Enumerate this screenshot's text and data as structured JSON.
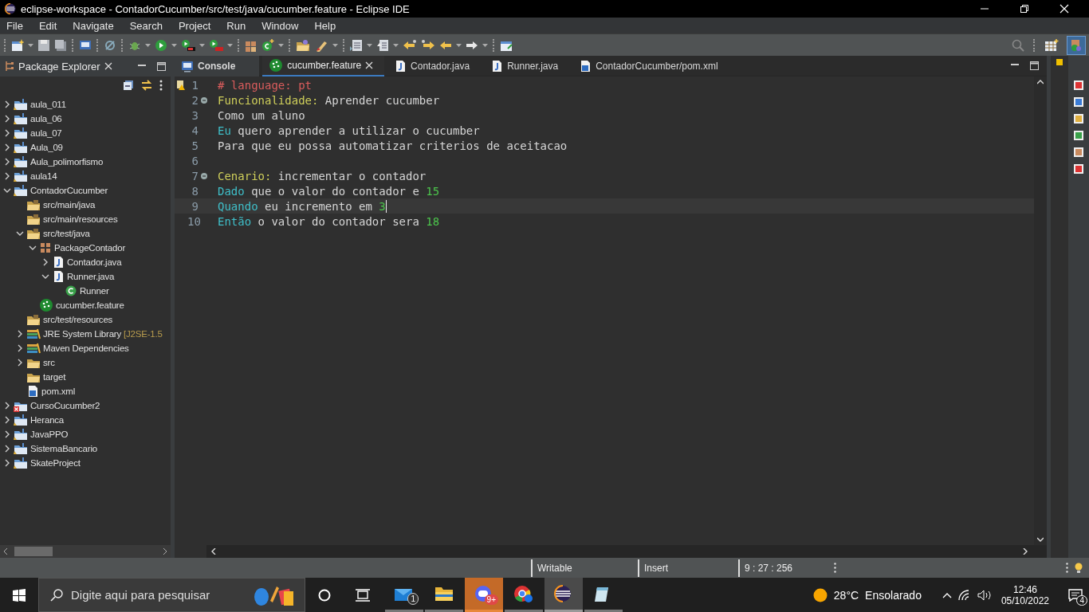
{
  "window": {
    "title": "eclipse-workspace - ContadorCucumber/src/test/java/cucumber.feature - Eclipse IDE"
  },
  "menu": [
    "File",
    "Edit",
    "Navigate",
    "Search",
    "Project",
    "Run",
    "Window",
    "Help"
  ],
  "explorer": {
    "title": "Package Explorer",
    "items": [
      {
        "label": "aula_011",
        "kind": "project",
        "expanded": false
      },
      {
        "label": "aula_06",
        "kind": "project",
        "expanded": false
      },
      {
        "label": "aula_07",
        "kind": "project",
        "expanded": false
      },
      {
        "label": "Aula_09",
        "kind": "project",
        "expanded": false
      },
      {
        "label": "Aula_polimorfismo",
        "kind": "project",
        "expanded": false
      },
      {
        "label": "aula14",
        "kind": "project",
        "expanded": false
      },
      {
        "label": "ContadorCucumber",
        "kind": "project",
        "expanded": true,
        "children": [
          {
            "label": "src/main/java",
            "kind": "source-folder"
          },
          {
            "label": "src/main/resources",
            "kind": "source-folder"
          },
          {
            "label": "src/test/java",
            "kind": "source-folder",
            "expanded": true,
            "children": [
              {
                "label": "PackageContador",
                "kind": "package",
                "expanded": true,
                "children": [
                  {
                    "label": "Contador.java",
                    "kind": "java",
                    "expanded": false
                  },
                  {
                    "label": "Runner.java",
                    "kind": "java",
                    "expanded": true,
                    "children": [
                      {
                        "label": "Runner",
                        "kind": "class"
                      }
                    ]
                  }
                ]
              },
              {
                "label": "cucumber.feature",
                "kind": "feature"
              }
            ]
          },
          {
            "label": "src/test/resources",
            "kind": "source-folder"
          },
          {
            "label": "JRE System Library",
            "decoration": "[J2SE-1.5",
            "kind": "library",
            "expanded": false
          },
          {
            "label": "Maven Dependencies",
            "kind": "library",
            "expanded": false
          },
          {
            "label": "src",
            "kind": "folder",
            "expanded": false
          },
          {
            "label": "target",
            "kind": "folder"
          },
          {
            "label": "pom.xml",
            "kind": "maven"
          }
        ]
      },
      {
        "label": "CursoCucumber2",
        "kind": "project-error",
        "expanded": false
      },
      {
        "label": "Heranca",
        "kind": "project",
        "expanded": false
      },
      {
        "label": "JavaPPO",
        "kind": "project",
        "expanded": false
      },
      {
        "label": "SistemaBancario",
        "kind": "project",
        "expanded": false
      },
      {
        "label": "SkateProject",
        "kind": "project",
        "expanded": false
      }
    ]
  },
  "editor": {
    "tabs": [
      {
        "label": "Console",
        "kind": "console",
        "selected": false
      },
      {
        "label": "cucumber.feature",
        "kind": "feature",
        "selected": true
      },
      {
        "label": "Contador.java",
        "kind": "java",
        "selected": false
      },
      {
        "label": "Runner.java",
        "kind": "java",
        "selected": false
      },
      {
        "label": "ContadorCucumber/pom.xml",
        "kind": "maven",
        "selected": false
      }
    ],
    "lines": [
      {
        "number": "1",
        "fold": false,
        "current": false,
        "segments": [
          {
            "kind": "comment",
            "text": "# language: pt"
          }
        ]
      },
      {
        "number": "2",
        "fold": true,
        "current": false,
        "segments": [
          {
            "kind": "feature",
            "text": "Funcionalidade:"
          },
          {
            "kind": "text",
            "text": " Aprender cucumber"
          }
        ]
      },
      {
        "number": "3",
        "fold": false,
        "current": false,
        "segments": [
          {
            "kind": "text",
            "text": "Como um aluno"
          }
        ]
      },
      {
        "number": "4",
        "fold": false,
        "current": false,
        "segments": [
          {
            "kind": "step",
            "text": "Eu"
          },
          {
            "kind": "text",
            "text": " quero aprender a utilizar o cucumber"
          }
        ]
      },
      {
        "number": "5",
        "fold": false,
        "current": false,
        "segments": [
          {
            "kind": "text",
            "text": "Para que eu possa automatizar criterios de aceitacao"
          }
        ]
      },
      {
        "number": "6",
        "fold": false,
        "current": false
      },
      {
        "number": "7",
        "fold": true,
        "current": false,
        "segments": [
          {
            "kind": "feature",
            "text": "Cenario:"
          },
          {
            "kind": "text",
            "text": " incrementar o contador"
          }
        ]
      },
      {
        "number": "8",
        "fold": false,
        "current": false,
        "segments": [
          {
            "kind": "step",
            "text": "Dado"
          },
          {
            "kind": "text",
            "text": " que o valor do contador e "
          },
          {
            "kind": "number",
            "text": "15"
          }
        ]
      },
      {
        "number": "9",
        "fold": false,
        "current": true,
        "segments": [
          {
            "kind": "step",
            "text": "Quando"
          },
          {
            "kind": "text",
            "text": " eu incremento em "
          },
          {
            "kind": "number",
            "text": "3"
          }
        ]
      },
      {
        "number": "10",
        "fold": false,
        "current": false,
        "segments": [
          {
            "kind": "step",
            "text": "Então"
          },
          {
            "kind": "text",
            "text": " o valor do contador sera "
          },
          {
            "kind": "number",
            "text": "18"
          }
        ]
      }
    ]
  },
  "status_bar": [
    "Writable",
    "Insert",
    "9 : 27 : 256"
  ],
  "taskbar": {
    "search": {
      "placeholder": "Digite aqui para pesquisar"
    },
    "apps": [
      {
        "kind": "mail",
        "badge": "1",
        "selected": false
      },
      {
        "kind": "files",
        "selected": false
      },
      {
        "kind": "chat",
        "badge": "9+",
        "selected": false
      },
      {
        "kind": "browser",
        "selected": false
      },
      {
        "kind": "eclipse",
        "selected": true
      },
      {
        "kind": "notepad",
        "selected": false
      }
    ],
    "weather": {
      "temperature": "28°C",
      "condition": "Ensolarado"
    },
    "time": "12:46",
    "date": "05/10/2022",
    "notifications": "4"
  }
}
